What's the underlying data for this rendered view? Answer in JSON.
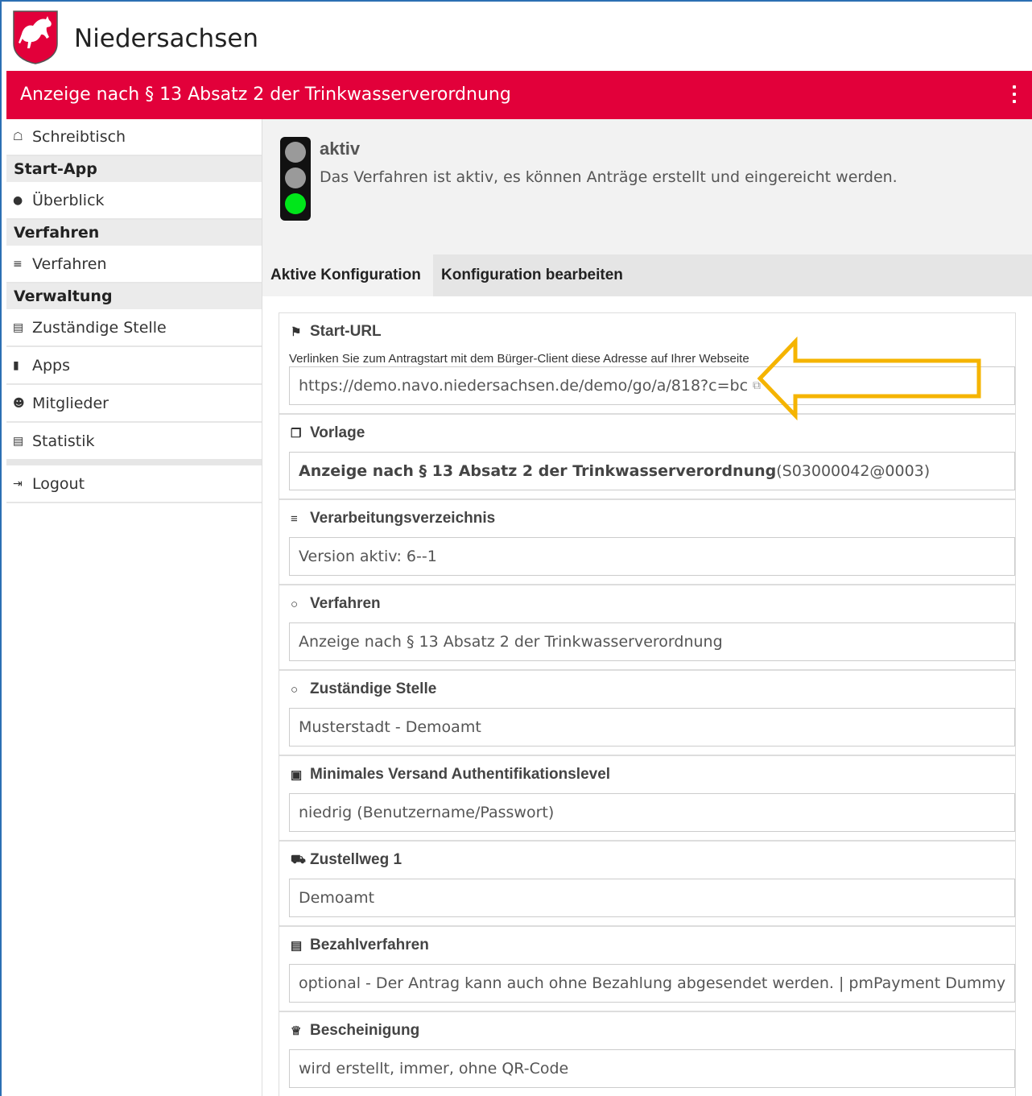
{
  "header": {
    "brand": "Niedersachsen",
    "title": "Anzeige nach § 13 Absatz 2 der Trinkwasserverordnung"
  },
  "colors": {
    "brand_red": "#e2003a",
    "light_green": "#00e61a",
    "light_gray": "#9a9a9a",
    "arrow": "#f5b400"
  },
  "sidebar": {
    "schreibtisch": "Schreibtisch",
    "group_start": "Start-App",
    "ueberblick": "Überblick",
    "group_verfahren": "Verfahren",
    "verfahren": "Verfahren",
    "group_verwaltung": "Verwaltung",
    "zustaendige_stelle": "Zuständige Stelle",
    "apps": "Apps",
    "mitglieder": "Mitglieder",
    "statistik": "Statistik",
    "logout": "Logout"
  },
  "status": {
    "title": "aktiv",
    "text": "Das Verfahren ist aktiv, es können Anträge erstellt und eingereicht werden.",
    "light": "green"
  },
  "tabs": {
    "active": "Aktive Konfiguration",
    "edit": "Konfiguration bearbeiten"
  },
  "cards": {
    "start_url": {
      "label": "Start-URL",
      "hint": "Verlinken Sie zum Antragstart mit dem Bürger-Client diese Adresse auf Ihrer Webseite",
      "value": "https://demo.navo.niedersachsen.de/demo/go/a/818?c=bc"
    },
    "vorlage": {
      "label": "Vorlage",
      "value_bold": "Anzeige nach § 13 Absatz 2 der Trinkwasserverordnung",
      "value_rest": " (S03000042@0003)"
    },
    "verarbeitung": {
      "label": "Verarbeitungsverzeichnis",
      "value": "Version aktiv: 6--1"
    },
    "verfahren": {
      "label": "Verfahren",
      "value": "Anzeige nach § 13 Absatz 2 der Trinkwasserverordnung"
    },
    "stelle": {
      "label": "Zuständige Stelle",
      "value": "Musterstadt - Demoamt"
    },
    "auth": {
      "label": "Minimales Versand Authentifikationslevel",
      "value": "niedrig (Benutzername/Passwort)"
    },
    "zustellweg": {
      "label": "Zustellweg 1",
      "value": "Demoamt"
    },
    "bezahl": {
      "label": "Bezahlverfahren",
      "value": "optional - Der Antrag kann auch ohne Bezahlung abgesendet werden. | pmPayment Dummy"
    },
    "bescheinigung": {
      "label": "Bescheinigung",
      "value": "wird erstellt, immer, ohne QR-Code"
    }
  }
}
